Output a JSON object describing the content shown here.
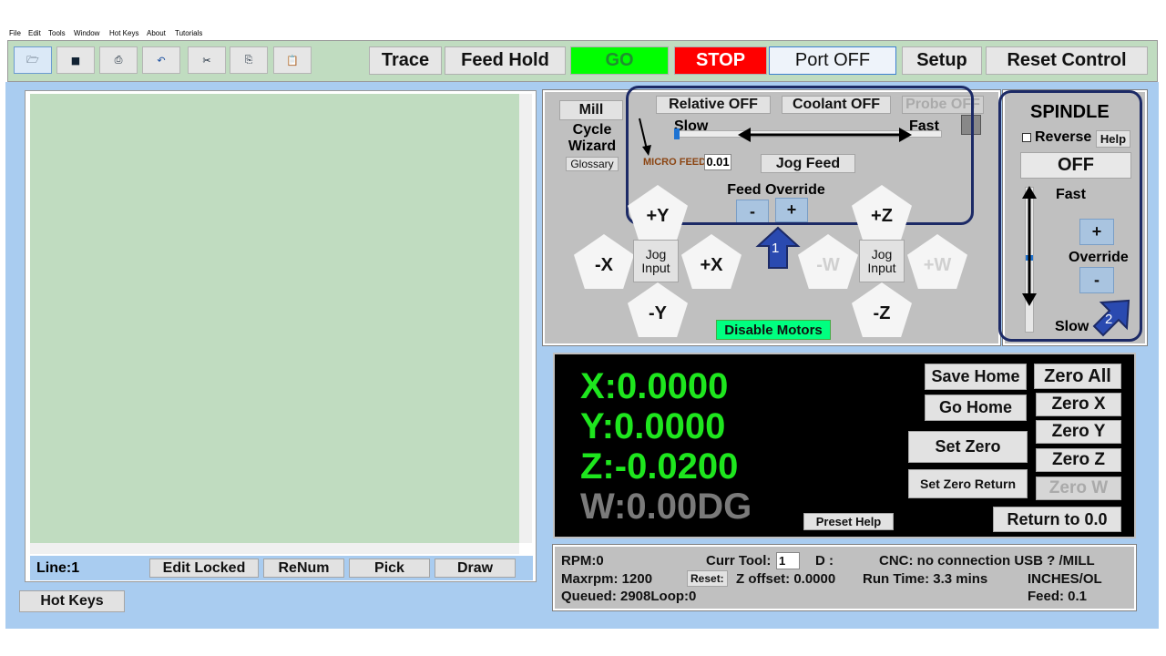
{
  "menu": {
    "items": [
      "File",
      "Edit",
      "Tools",
      "Window",
      "Hot Keys",
      "About",
      "Tutorials"
    ]
  },
  "toolbar": {
    "icons": [
      "open-folder-icon",
      "save-icon",
      "print-icon",
      "undo-icon",
      "cut-icon",
      "copy-icon",
      "paste-icon"
    ],
    "trace": "Trace",
    "feed_hold": "Feed Hold",
    "go": "GO",
    "stop": "STOP",
    "port": "Port OFF",
    "setup": "Setup",
    "reset_control": "Reset Control",
    "go_color": "#00ff00",
    "stop_color": "#ff0000"
  },
  "editor": {
    "line": "Line:1",
    "edit_locked": "Edit Locked",
    "renum": "ReNum",
    "pick": "Pick",
    "draw": "Draw",
    "hot_keys": "Hot Keys",
    "bg_color": "#c0dcc0"
  },
  "jog": {
    "mill": "Mill",
    "cycle_wizard": "Cycle Wizard",
    "glossary": "Glossary",
    "relative": "Relative OFF",
    "coolant": "Coolant OFF",
    "probe": "Probe OFF",
    "slow": "Slow",
    "fast": "Fast",
    "micro_feed_label": "MICRO FEED",
    "micro_feed_value": "0.01",
    "jog_feed": "Jog Feed",
    "feed_override": "Feed Override",
    "minus": "-",
    "plus": "+",
    "plus_y": "+Y",
    "minus_y": "-Y",
    "plus_x": "+X",
    "minus_x": "-X",
    "plus_z": "+Z",
    "minus_z": "-Z",
    "plus_w": "+W",
    "minus_w": "-W",
    "jog_input": "Jog Input",
    "disable_motors": "Disable Motors",
    "callout_1": "1"
  },
  "spindle": {
    "title": "SPINDLE",
    "reverse": "Reverse",
    "help": "Help",
    "state": "OFF",
    "fast": "Fast",
    "plus": "+",
    "override": "Override",
    "minus": "-",
    "slow": "Slow",
    "callout_2": "2"
  },
  "dro": {
    "x": "X:0.0000",
    "y": "Y:0.0000",
    "z": "Z:-0.0200",
    "w": "W:0.00DG",
    "save_home": "Save Home",
    "go_home": "Go Home",
    "set_zero": "Set Zero",
    "set_zero_return": "Set Zero Return",
    "zero_all": "Zero All",
    "zero_x": "Zero X",
    "zero_y": "Zero Y",
    "zero_z": "Zero Z",
    "zero_w": "Zero W",
    "preset_help": "Preset Help",
    "return_to_zero": "Return to 0.0"
  },
  "status": {
    "rpm": "RPM:0",
    "curr_tool_label": "Curr Tool:",
    "curr_tool_value": "1",
    "d": "D :",
    "cnc": "CNC: no connection USB ? /MILL",
    "maxrpm": "Maxrpm: 1200",
    "reset": "Reset:",
    "z_offset": "Z offset: 0.0000",
    "run_time": "Run Time: 3.3 mins",
    "units": "INCHES/OL",
    "queued": "Queued: 2908Loop:0",
    "feed": "Feed: 0.1"
  }
}
